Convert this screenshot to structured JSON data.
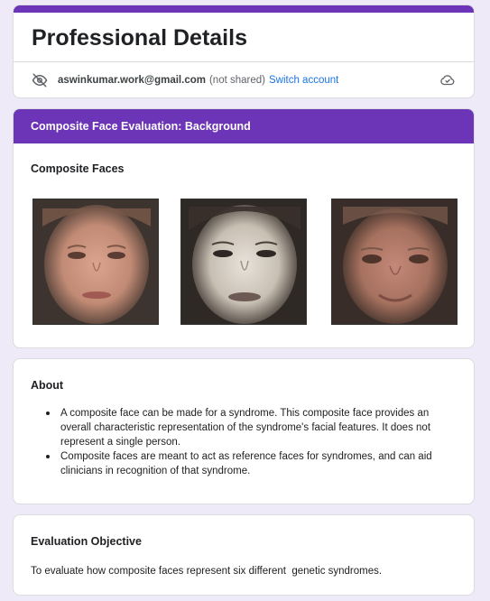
{
  "header": {
    "title": "Professional Details",
    "account_email": "aswinkumar.work@gmail.com",
    "not_shared": "(not shared)",
    "switch_account": "Switch account",
    "accent_color": "#6c34b6"
  },
  "section": {
    "title": "Composite Face Evaluation: Background",
    "subtitle": "Composite Faces",
    "images": [
      {
        "icon": "composite-face-image-1"
      },
      {
        "icon": "composite-face-image-2"
      },
      {
        "icon": "composite-face-image-3"
      }
    ]
  },
  "about": {
    "title": "About",
    "items": [
      "A composite face can be made for a syndrome. This composite face provides an overall characteristic representation of the syndrome's facial features. It does not represent a single person.",
      "Composite faces are meant to act as reference faces for syndromes, and can aid clinicians in recognition of that syndrome."
    ]
  },
  "objective": {
    "title": "Evaluation Objective",
    "text": "To evaluate how composite faces represent six different  genetic syndromes."
  }
}
